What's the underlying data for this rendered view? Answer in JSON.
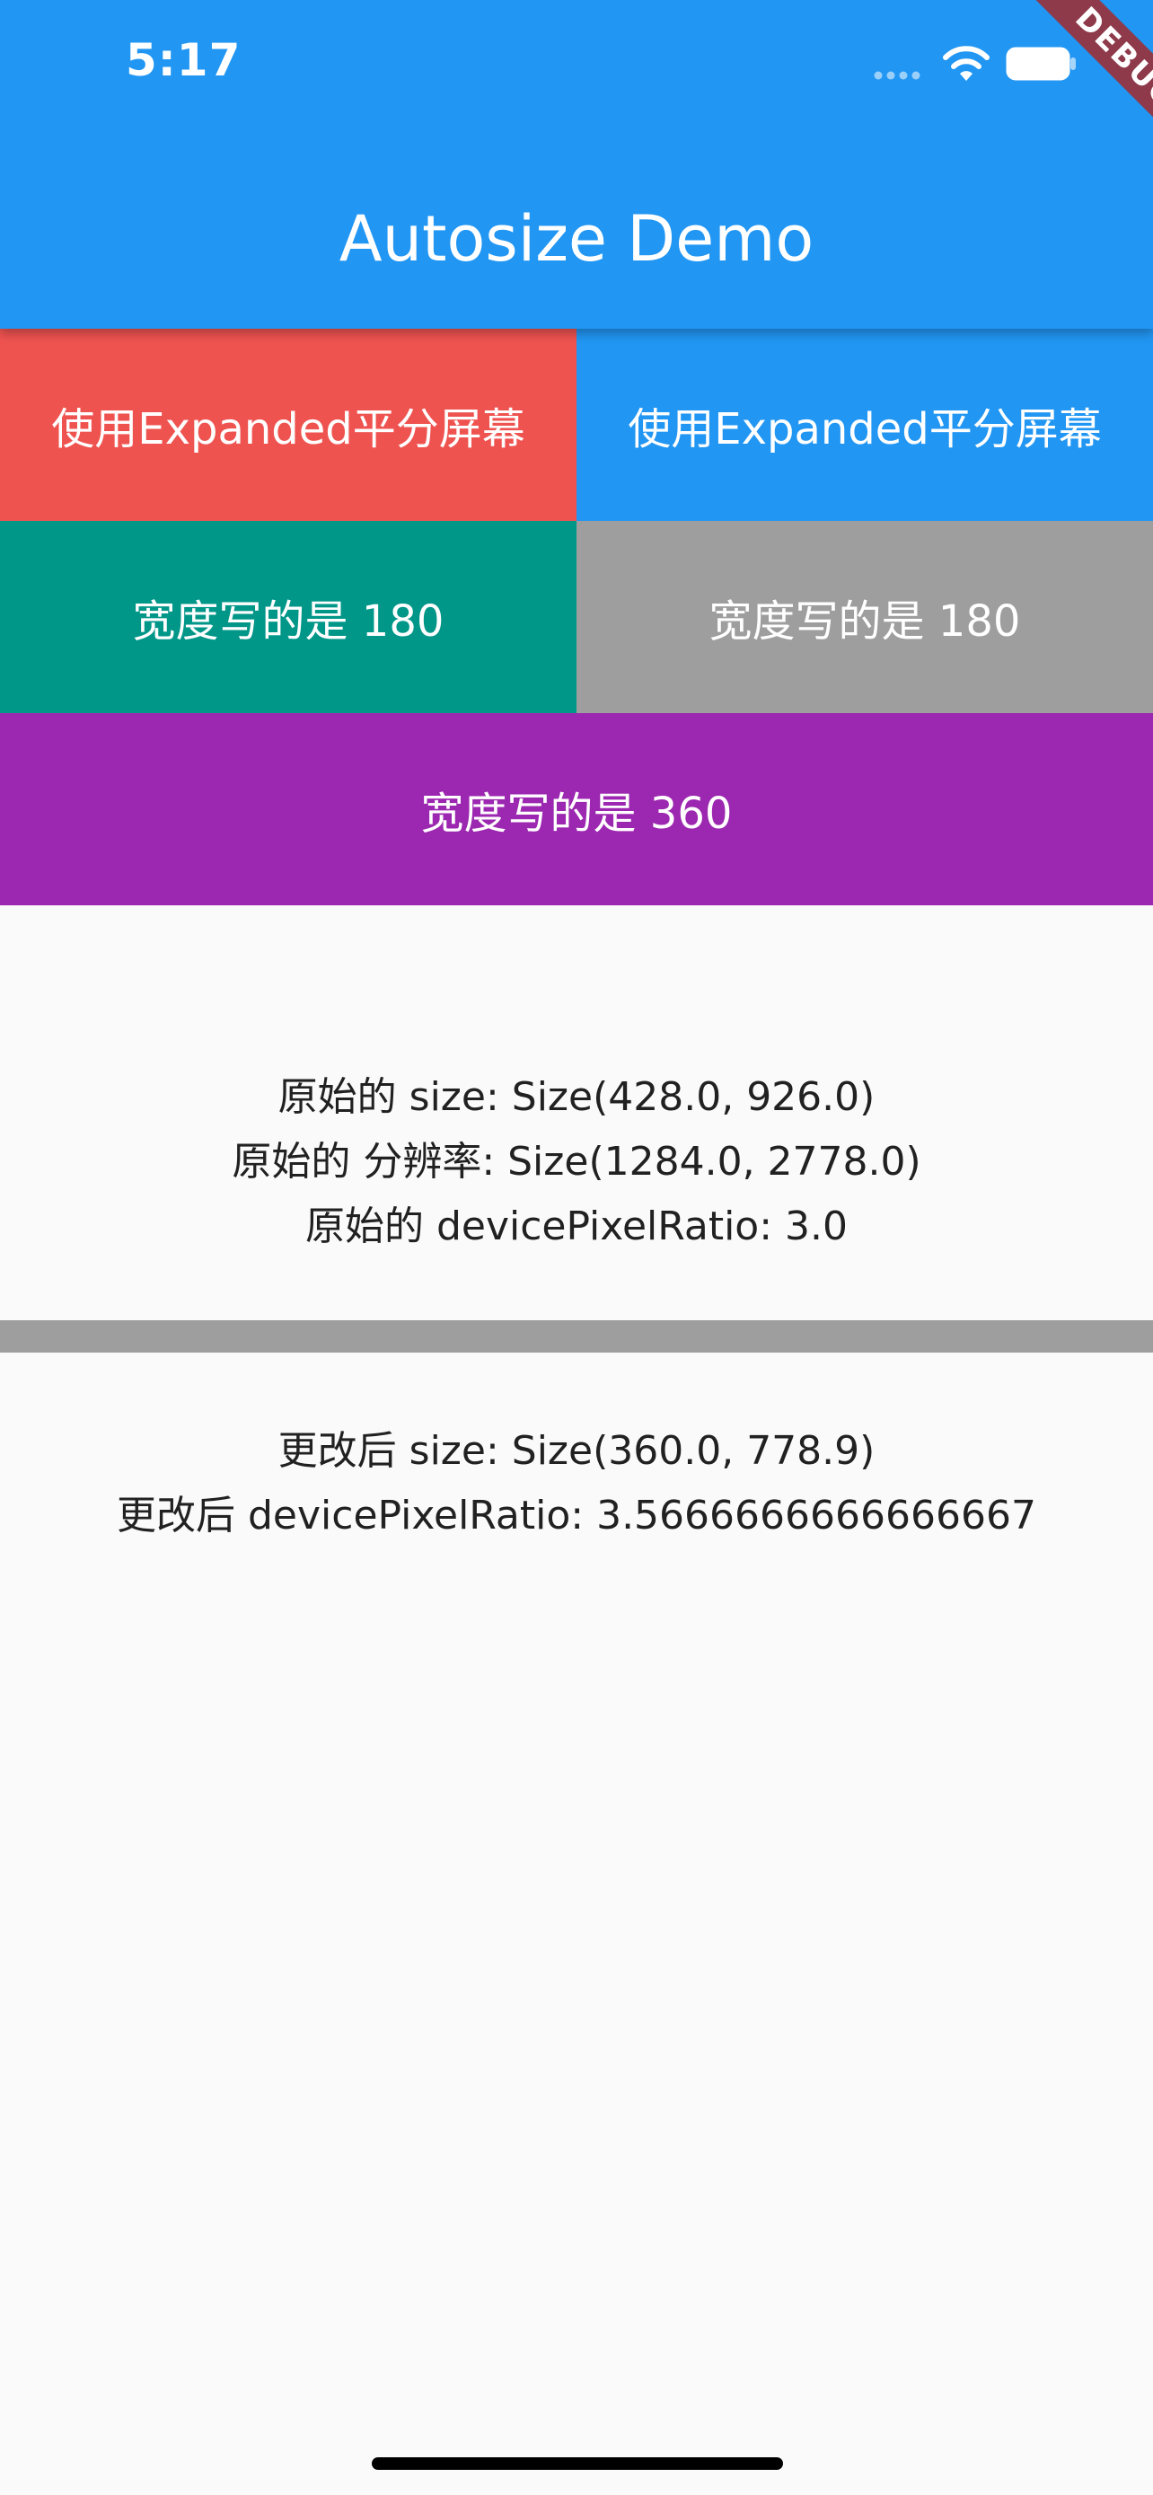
{
  "status_bar": {
    "time": "5:17",
    "icons": [
      "signal-icon",
      "wifi-icon",
      "battery-icon"
    ]
  },
  "debug_banner": "DEBUG",
  "app_bar": {
    "title": "Autosize Demo",
    "color": "#2196f3"
  },
  "blocks": [
    {
      "label": "使用Expanded平分屏幕",
      "color": "#ef5350"
    },
    {
      "label": "使用Expanded平分屏幕",
      "color": "#2196f3"
    },
    {
      "label": "宽度写的是 180",
      "color": "#009688"
    },
    {
      "label": "宽度写的是 180",
      "color": "#9e9e9e"
    },
    {
      "label": "宽度写的是 360",
      "color": "#9c27b0"
    }
  ],
  "original": {
    "size": "原始的 size: Size(428.0, 926.0)",
    "resolution": "原始的 分辨率: Size(1284.0, 2778.0)",
    "pixel_ratio": "原始的 devicePixelRatio: 3.0"
  },
  "changed": {
    "size": "更改后 size: Size(360.0, 778.9)",
    "pixel_ratio": "更改后 devicePixelRatio: 3.5666666666666667"
  }
}
